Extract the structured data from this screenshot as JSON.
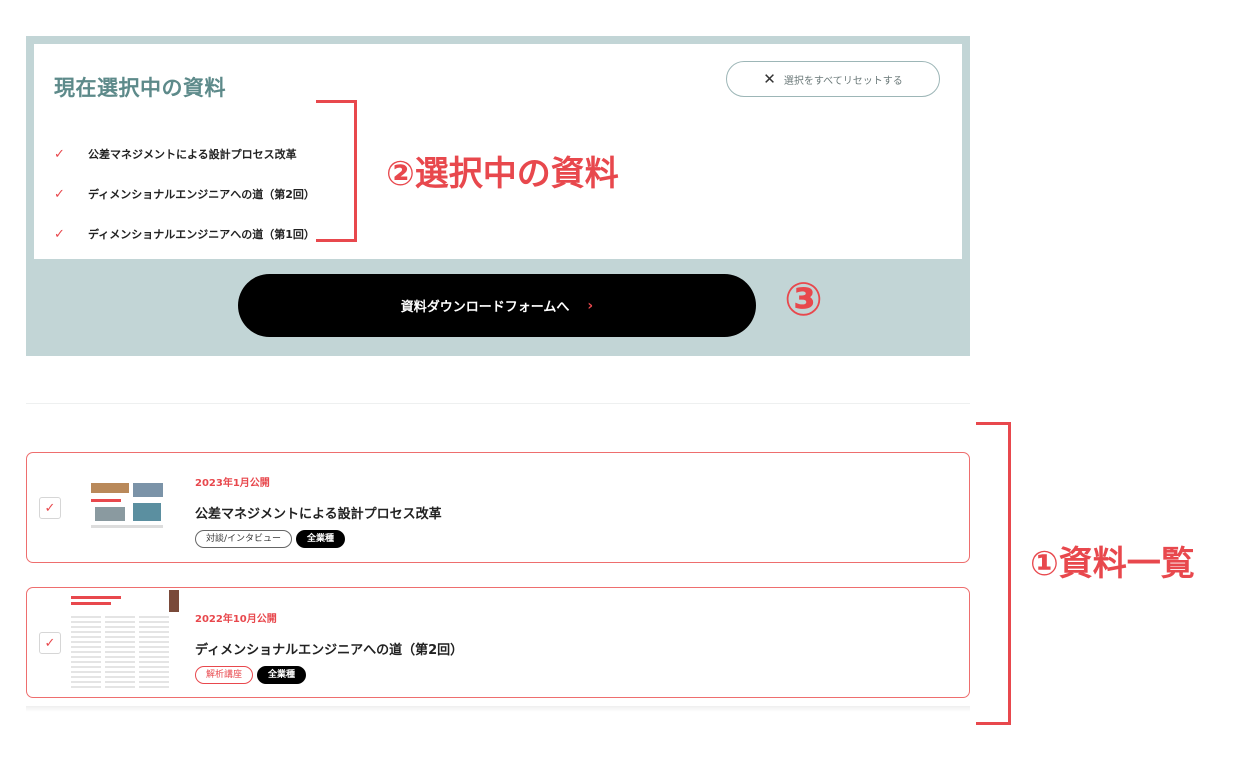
{
  "selected_panel": {
    "title": "現在選択中の資料",
    "reset_label": "選択をすべてリセットする",
    "items": [
      "公差マネジメントによる設計プロセス改革",
      "ディメンショナルエンジニアへの道（第2回）",
      "ディメンショナルエンジニアへの道（第1回）"
    ]
  },
  "download_button": {
    "label": "資料ダウンロードフォームへ"
  },
  "cards": [
    {
      "date": "2023年1月公開",
      "title": "公差マネジメントによる設計プロセス改革",
      "tags": [
        "対談/インタビュー",
        "全業種"
      ],
      "checked": true
    },
    {
      "date": "2022年10月公開",
      "title": "ディメンショナルエンジニアへの道（第2回）",
      "tags": [
        "解析講座",
        "全業種"
      ],
      "checked": true
    }
  ],
  "annotations": {
    "selected": "②選択中の資料",
    "download": "③",
    "list": "①資料一覧"
  },
  "colors": {
    "accent": "#e8484d",
    "panel_bg": "#c2d5d6",
    "title_teal": "#5d8a8a"
  }
}
